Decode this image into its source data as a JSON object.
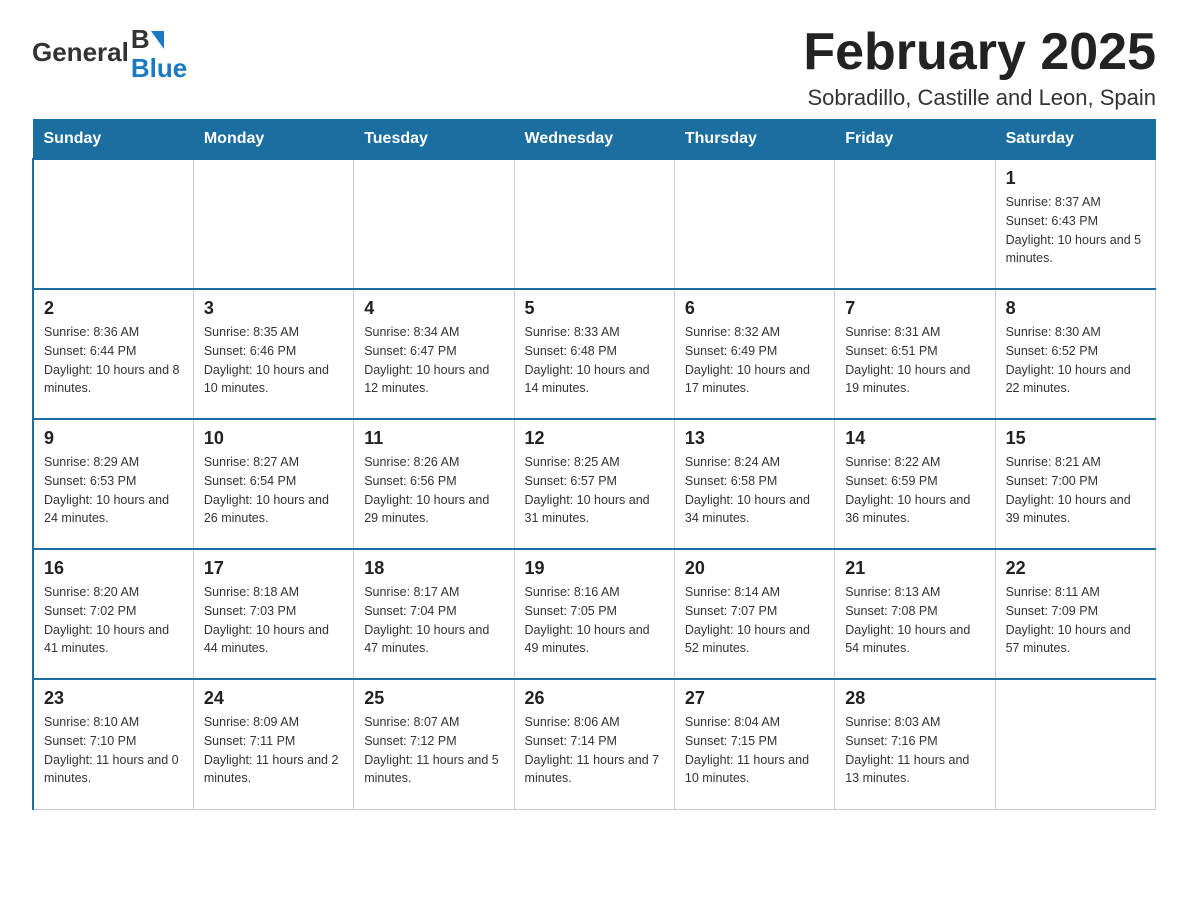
{
  "header": {
    "logo_general": "General",
    "logo_blue": "Blue",
    "month_title": "February 2025",
    "location": "Sobradillo, Castille and Leon, Spain"
  },
  "days_of_week": [
    "Sunday",
    "Monday",
    "Tuesday",
    "Wednesday",
    "Thursday",
    "Friday",
    "Saturday"
  ],
  "weeks": [
    [
      {
        "day": "",
        "info": ""
      },
      {
        "day": "",
        "info": ""
      },
      {
        "day": "",
        "info": ""
      },
      {
        "day": "",
        "info": ""
      },
      {
        "day": "",
        "info": ""
      },
      {
        "day": "",
        "info": ""
      },
      {
        "day": "1",
        "info": "Sunrise: 8:37 AM\nSunset: 6:43 PM\nDaylight: 10 hours and 5 minutes."
      }
    ],
    [
      {
        "day": "2",
        "info": "Sunrise: 8:36 AM\nSunset: 6:44 PM\nDaylight: 10 hours and 8 minutes."
      },
      {
        "day": "3",
        "info": "Sunrise: 8:35 AM\nSunset: 6:46 PM\nDaylight: 10 hours and 10 minutes."
      },
      {
        "day": "4",
        "info": "Sunrise: 8:34 AM\nSunset: 6:47 PM\nDaylight: 10 hours and 12 minutes."
      },
      {
        "day": "5",
        "info": "Sunrise: 8:33 AM\nSunset: 6:48 PM\nDaylight: 10 hours and 14 minutes."
      },
      {
        "day": "6",
        "info": "Sunrise: 8:32 AM\nSunset: 6:49 PM\nDaylight: 10 hours and 17 minutes."
      },
      {
        "day": "7",
        "info": "Sunrise: 8:31 AM\nSunset: 6:51 PM\nDaylight: 10 hours and 19 minutes."
      },
      {
        "day": "8",
        "info": "Sunrise: 8:30 AM\nSunset: 6:52 PM\nDaylight: 10 hours and 22 minutes."
      }
    ],
    [
      {
        "day": "9",
        "info": "Sunrise: 8:29 AM\nSunset: 6:53 PM\nDaylight: 10 hours and 24 minutes."
      },
      {
        "day": "10",
        "info": "Sunrise: 8:27 AM\nSunset: 6:54 PM\nDaylight: 10 hours and 26 minutes."
      },
      {
        "day": "11",
        "info": "Sunrise: 8:26 AM\nSunset: 6:56 PM\nDaylight: 10 hours and 29 minutes."
      },
      {
        "day": "12",
        "info": "Sunrise: 8:25 AM\nSunset: 6:57 PM\nDaylight: 10 hours and 31 minutes."
      },
      {
        "day": "13",
        "info": "Sunrise: 8:24 AM\nSunset: 6:58 PM\nDaylight: 10 hours and 34 minutes."
      },
      {
        "day": "14",
        "info": "Sunrise: 8:22 AM\nSunset: 6:59 PM\nDaylight: 10 hours and 36 minutes."
      },
      {
        "day": "15",
        "info": "Sunrise: 8:21 AM\nSunset: 7:00 PM\nDaylight: 10 hours and 39 minutes."
      }
    ],
    [
      {
        "day": "16",
        "info": "Sunrise: 8:20 AM\nSunset: 7:02 PM\nDaylight: 10 hours and 41 minutes."
      },
      {
        "day": "17",
        "info": "Sunrise: 8:18 AM\nSunset: 7:03 PM\nDaylight: 10 hours and 44 minutes."
      },
      {
        "day": "18",
        "info": "Sunrise: 8:17 AM\nSunset: 7:04 PM\nDaylight: 10 hours and 47 minutes."
      },
      {
        "day": "19",
        "info": "Sunrise: 8:16 AM\nSunset: 7:05 PM\nDaylight: 10 hours and 49 minutes."
      },
      {
        "day": "20",
        "info": "Sunrise: 8:14 AM\nSunset: 7:07 PM\nDaylight: 10 hours and 52 minutes."
      },
      {
        "day": "21",
        "info": "Sunrise: 8:13 AM\nSunset: 7:08 PM\nDaylight: 10 hours and 54 minutes."
      },
      {
        "day": "22",
        "info": "Sunrise: 8:11 AM\nSunset: 7:09 PM\nDaylight: 10 hours and 57 minutes."
      }
    ],
    [
      {
        "day": "23",
        "info": "Sunrise: 8:10 AM\nSunset: 7:10 PM\nDaylight: 11 hours and 0 minutes."
      },
      {
        "day": "24",
        "info": "Sunrise: 8:09 AM\nSunset: 7:11 PM\nDaylight: 11 hours and 2 minutes."
      },
      {
        "day": "25",
        "info": "Sunrise: 8:07 AM\nSunset: 7:12 PM\nDaylight: 11 hours and 5 minutes."
      },
      {
        "day": "26",
        "info": "Sunrise: 8:06 AM\nSunset: 7:14 PM\nDaylight: 11 hours and 7 minutes."
      },
      {
        "day": "27",
        "info": "Sunrise: 8:04 AM\nSunset: 7:15 PM\nDaylight: 11 hours and 10 minutes."
      },
      {
        "day": "28",
        "info": "Sunrise: 8:03 AM\nSunset: 7:16 PM\nDaylight: 11 hours and 13 minutes."
      },
      {
        "day": "",
        "info": ""
      }
    ]
  ]
}
